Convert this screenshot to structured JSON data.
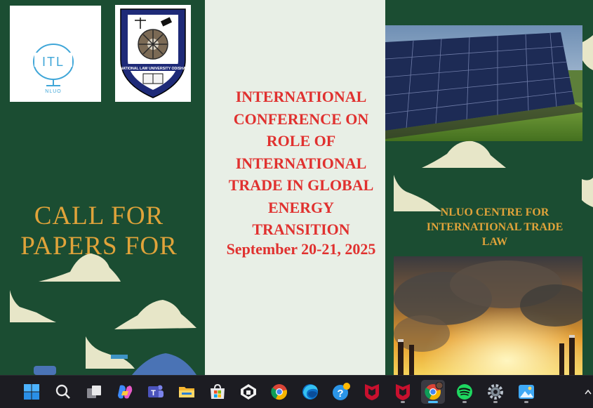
{
  "left": {
    "itl_logo_text": "ITL",
    "itl_logo_sub": "NLUO",
    "nluo_seal_text": "NATIONAL LAW UNIVERSITY ODISHA",
    "call_line1": "CALL FOR",
    "call_line2": "PAPERS FOR"
  },
  "center": {
    "title_lines": [
      "INTERNATIONAL",
      "CONFERENCE ON",
      "ROLE OF",
      "INTERNATIONAL",
      "TRADE IN GLOBAL",
      "ENERGY",
      "TRANSITION"
    ],
    "date": "September 20-21, 2025"
  },
  "right": {
    "centre_lines": [
      "NLUO CENTRE FOR",
      "INTERNATIONAL TRADE",
      "LAW"
    ]
  },
  "colors": {
    "background_green": "#1b4d32",
    "center_panel": "#e8efe6",
    "title_red": "#e0312f",
    "accent_gold": "#e0a33a",
    "taskbar": "#1c1c22"
  },
  "taskbar": {
    "icons": [
      "windows-start-icon",
      "search-icon",
      "task-view-icon",
      "copilot-icon",
      "teams-icon",
      "file-explorer-icon",
      "microsoft-store-icon",
      "app-icon",
      "chrome-icon",
      "edge-icon",
      "help-icon",
      "mcafee-icon",
      "mcafee-icon",
      "chrome-profile-icon",
      "spotify-icon",
      "settings-icon",
      "photos-icon"
    ],
    "active_icon": "chrome-profile-icon"
  }
}
